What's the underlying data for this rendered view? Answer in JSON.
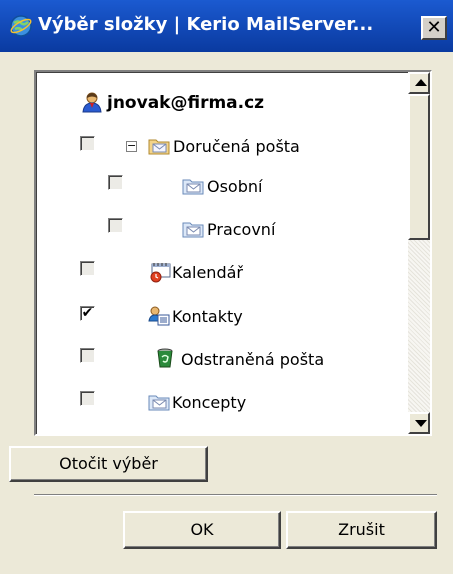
{
  "window": {
    "title": "Výběr složky | Kerio MailServer...",
    "close_label": "✕"
  },
  "tree": {
    "root": {
      "label": "jnovak@firma.cz",
      "icon": "user-icon"
    },
    "items": [
      {
        "label": "Doručená pošta",
        "icon": "folder-icon",
        "checked": false,
        "expander": "−"
      },
      {
        "label": "Osobní",
        "icon": "folder-icon",
        "checked": false
      },
      {
        "label": "Pracovní",
        "icon": "folder-icon",
        "checked": false
      },
      {
        "label": "Kalendář",
        "icon": "calendar-icon",
        "checked": false
      },
      {
        "label": "Kontakty",
        "icon": "contacts-icon",
        "checked": true,
        "check_mark": "✔"
      },
      {
        "label": "Odstraněná pošta",
        "icon": "trash-icon",
        "checked": false
      },
      {
        "label": "Koncepty",
        "icon": "folder-icon",
        "checked": false
      }
    ]
  },
  "buttons": {
    "invert": "Otočit výběr",
    "ok": "OK",
    "cancel": "Zrušit"
  },
  "colors": {
    "titlebar": "#0a3aa0",
    "dialog_bg": "#ece9d8"
  }
}
